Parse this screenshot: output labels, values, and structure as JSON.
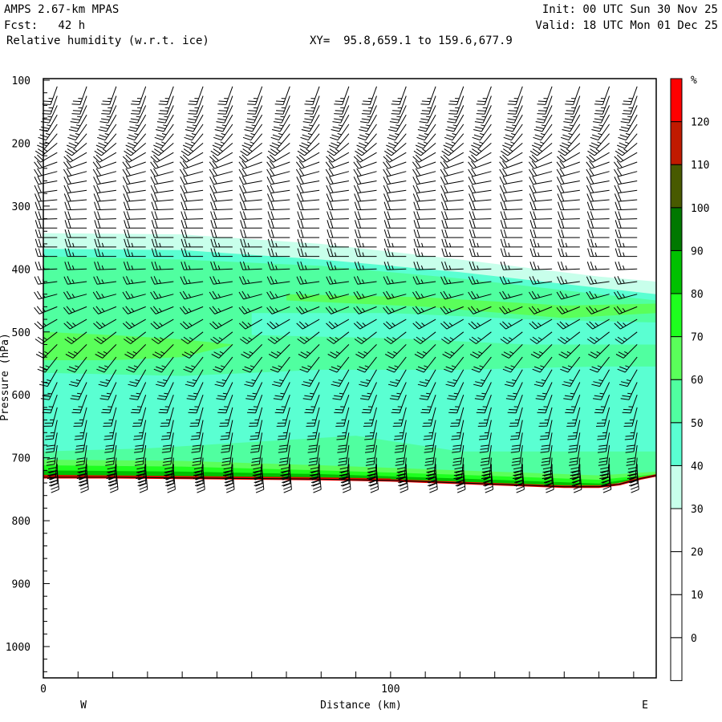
{
  "header": {
    "model": "AMPS 2.67-km MPAS",
    "forecast": "Fcst:   42 h",
    "field": "Relative humidity (w.r.t. ice)",
    "xy": "XY=  95.8,659.1 to 159.6,677.9",
    "init": "Init: 00 UTC Sun 30 Nov 25",
    "valid": "Valid: 18 UTC Mon 01 Dec 25"
  },
  "chart_data": {
    "type": "cross-section",
    "title": "Relative humidity (w.r.t. ice)",
    "xlabel": "Distance (km)",
    "ylabel": "Pressure (hPa)",
    "xlim": [
      0,
      176.5
    ],
    "ylim": [
      1050,
      100
    ],
    "xticks": [
      0,
      100
    ],
    "xtick_labels": [
      "0",
      "100"
    ],
    "x_minor_step": 10,
    "yticks": [
      100,
      200,
      300,
      400,
      500,
      600,
      700,
      800,
      900,
      1000
    ],
    "ytick_labels": [
      "100",
      "200",
      "300",
      "400",
      "500",
      "600",
      "700",
      "800",
      "900",
      "1000"
    ],
    "left_end_label": "W",
    "right_end_label": "E",
    "colorbar": {
      "unit": "%",
      "levels": [
        0,
        10,
        20,
        30,
        40,
        50,
        60,
        70,
        80,
        90,
        100,
        110,
        120
      ],
      "level_labels": [
        "0",
        "10",
        "20",
        "30",
        "40",
        "50",
        "60",
        "70",
        "80",
        "90",
        "100",
        "110",
        "120"
      ],
      "colors": [
        "#ffffff",
        "#ffffff",
        "#ffffff",
        "#ffffff",
        "#c8ffeb",
        "#5affd2",
        "#50ffa0",
        "#5aff5a",
        "#1eff1e",
        "#00c000",
        "#007800",
        "#485a00",
        "#c01a00",
        "#ff0000"
      ]
    },
    "terrain": {
      "distance": [
        0,
        20,
        40,
        60,
        80,
        100,
        110,
        120,
        130,
        140,
        150,
        160,
        166,
        172,
        176.5
      ],
      "pressure": [
        731,
        731,
        732,
        733,
        734,
        736,
        738,
        740,
        742,
        744,
        746,
        746,
        742,
        733,
        728
      ]
    },
    "rh_regions": [
      {
        "rh_band": "30-40",
        "color": "#c8ffeb",
        "top": {
          "distance": [
            0,
            40,
            80,
            120,
            160,
            176.5
          ],
          "pressure": [
            343,
            345,
            360,
            385,
            412,
            420
          ]
        }
      },
      {
        "rh_band": "40-50",
        "color": "#5affd2",
        "top": {
          "distance": [
            0,
            40,
            80,
            120,
            160,
            176.5
          ],
          "pressure": [
            368,
            370,
            385,
            405,
            430,
            440
          ]
        }
      },
      {
        "rh_band": "50-60",
        "color": "#50ffa0",
        "top": {
          "distance": [
            0,
            40,
            80,
            120,
            160,
            176.5
          ],
          "pressure": [
            380,
            385,
            395,
            415,
            440,
            450
          ]
        }
      }
    ],
    "rh_patches": [
      {
        "rh_band": "40-50",
        "color": "#5affd2",
        "distance": [
          0,
          40,
          80,
          120,
          160,
          176.5,
          176.5,
          160,
          120,
          80,
          40,
          0
        ],
        "pressure": [
          565,
          570,
          560,
          560,
          555,
          555,
          690,
          690,
          690,
          690,
          690,
          690
        ]
      },
      {
        "rh_band": "40-50",
        "color": "#5affd2",
        "distance": [
          60,
          100,
          140,
          176.5,
          176.5,
          140,
          100,
          60
        ],
        "pressure": [
          470,
          470,
          480,
          485,
          520,
          520,
          510,
          505
        ]
      },
      {
        "rh_band": "60-70",
        "color": "#5aff5a",
        "distance": [
          0,
          20,
          40,
          55,
          40,
          20,
          0
        ],
        "pressure": [
          500,
          505,
          512,
          520,
          540,
          545,
          545
        ]
      },
      {
        "rh_band": "60-70",
        "color": "#5aff5a",
        "distance": [
          70,
          110,
          150,
          176.5,
          176.5,
          150,
          110,
          70
        ],
        "pressure": [
          440,
          445,
          458,
          455,
          470,
          478,
          460,
          450
        ]
      },
      {
        "rh_band": "50-60",
        "color": "#50ffa0",
        "distance": [
          0,
          30,
          60,
          90,
          120,
          150,
          176.5,
          176.5,
          150,
          120,
          90,
          60,
          30,
          0
        ],
        "pressure": [
          690,
          685,
          675,
          665,
          690,
          700,
          705,
          728,
          746,
          740,
          734,
          733,
          731,
          731
        ]
      },
      {
        "rh_band": "60-70",
        "color": "#5aff5a",
        "distance": [
          0,
          40,
          80,
          120,
          160,
          176.5,
          176.5,
          160,
          120,
          80,
          40,
          0
        ],
        "pressure": [
          703,
          705,
          712,
          720,
          728,
          722,
          728,
          746,
          740,
          734,
          732,
          731
        ]
      },
      {
        "rh_band": "70-80",
        "color": "#1eff1e",
        "distance": [
          0,
          40,
          80,
          120,
          160,
          176.5,
          176.5,
          160,
          120,
          80,
          40,
          0
        ],
        "pressure": [
          712,
          714,
          720,
          727,
          735,
          726,
          728,
          746,
          740,
          734,
          732,
          731
        ]
      },
      {
        "rh_band": "80-90",
        "color": "#00c000",
        "distance": [
          0,
          40,
          80,
          120,
          160,
          176.5,
          176.5,
          160,
          120,
          80,
          40,
          0
        ],
        "pressure": [
          720,
          722,
          726,
          733,
          741,
          728,
          728,
          746,
          740,
          734,
          732,
          731
        ]
      },
      {
        "rh_band": "110-120",
        "color": "#c01a00",
        "distance": [
          0,
          40,
          80,
          100,
          100,
          80,
          40,
          0
        ],
        "pressure": [
          727,
          729,
          731,
          733,
          736,
          734,
          732,
          731
        ]
      }
    ],
    "barbs": {
      "column_distance": [
        4,
        12.5,
        21,
        29.5,
        37.5,
        46,
        54.5,
        63,
        71,
        79.5,
        88,
        96,
        104.5,
        113,
        121,
        129,
        138,
        146.5,
        154.5,
        163,
        171
      ],
      "levels_hpa": [
        110,
        125,
        140,
        155,
        170,
        185,
        200,
        215,
        230,
        245,
        260,
        275,
        290,
        305,
        320,
        335,
        350,
        365,
        380,
        400,
        420,
        440,
        460,
        480,
        500,
        520,
        540,
        560,
        580,
        600,
        620,
        640,
        660,
        680,
        700,
        710,
        720
      ],
      "direction_deg": [
        200,
        200,
        205,
        210,
        215,
        220,
        230,
        240,
        250,
        255,
        260,
        262,
        265,
        268,
        268,
        270,
        270,
        270,
        270,
        268,
        262,
        255,
        248,
        240,
        232,
        225,
        218,
        210,
        205,
        200,
        195,
        192,
        190,
        188,
        185,
        180,
        175
      ],
      "speed_kt": [
        25,
        25,
        25,
        25,
        25,
        25,
        25,
        20,
        20,
        20,
        20,
        20,
        20,
        20,
        20,
        20,
        20,
        25,
        25,
        25,
        25,
        25,
        25,
        25,
        25,
        25,
        25,
        25,
        25,
        25,
        25,
        25,
        30,
        30,
        40,
        50,
        55
      ]
    }
  }
}
